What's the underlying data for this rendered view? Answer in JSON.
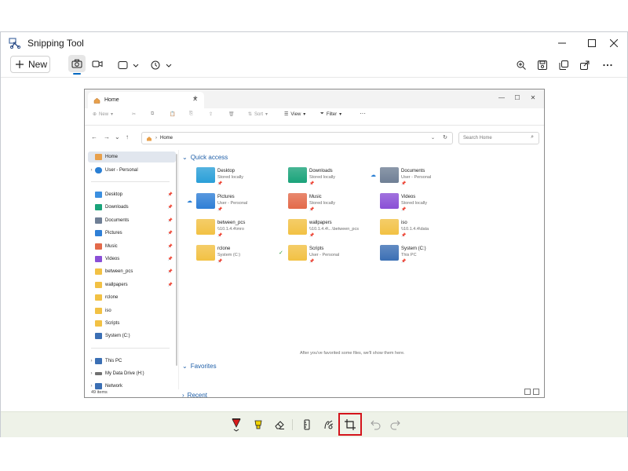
{
  "window": {
    "title": "Snipping Tool",
    "controls": [
      "minimize",
      "maximize",
      "close"
    ]
  },
  "toolbar": {
    "new_label": "New",
    "left_icons": [
      "camera-icon",
      "video-icon",
      "snip-shape-icon",
      "timer-icon"
    ],
    "right_icons": [
      "zoom-icon",
      "save-icon",
      "copy-icon",
      "share-icon",
      "more-icon"
    ]
  },
  "bottom_tools": {
    "items": [
      "ballpoint-pen",
      "highlighter",
      "eraser",
      "ruler",
      "touch-writing",
      "crop",
      "undo",
      "redo"
    ],
    "highlighted": "crop",
    "highlight_color": "#d4141c"
  },
  "explorer": {
    "tab_title": "Home",
    "command_bar": {
      "new": "New",
      "sort": "Sort",
      "view": "View",
      "filter": "Filter",
      "more": "···"
    },
    "address": "Home",
    "search_placeholder": "Search Home",
    "nav": {
      "home": "Home",
      "personal": "User - Personal",
      "pinned": [
        "Desktop",
        "Downloads",
        "Documents",
        "Pictures",
        "Music",
        "Videos",
        "between_pcs",
        "wallpapers",
        "rclone",
        "iso",
        "Scripts",
        "System (C:)"
      ],
      "drives": [
        "This PC",
        "My Data Drive (H:)",
        "Network"
      ]
    },
    "quick_access_title": "Quick access",
    "quick_access": [
      {
        "name": "Desktop",
        "sub": "Stored locally",
        "color": "#2a9fd8"
      },
      {
        "name": "Downloads",
        "sub": "Stored locally",
        "color": "#1aa37a"
      },
      {
        "name": "Documents",
        "sub": "User - Personal",
        "color": "#6f7f95"
      },
      {
        "name": "Pictures",
        "sub": "User - Personal",
        "color": "#2f7fd6"
      },
      {
        "name": "Music",
        "sub": "Stored locally",
        "color": "#e36a4a"
      },
      {
        "name": "Videos",
        "sub": "Stored locally",
        "color": "#8a4fd6"
      },
      {
        "name": "between_pcs",
        "sub": "\\\\10.1.4.4\\mro",
        "color": "#f2c144"
      },
      {
        "name": "wallpapers",
        "sub": "\\\\10.1.4.4\\...\\between_pcs",
        "color": "#f2c144"
      },
      {
        "name": "iso",
        "sub": "\\\\10.1.4.4\\data",
        "color": "#f2c144"
      },
      {
        "name": "rclone",
        "sub": "System (C:)",
        "color": "#f2c144"
      },
      {
        "name": "Scripts",
        "sub": "User - Personal",
        "color": "#f2c144"
      },
      {
        "name": "System (C:)",
        "sub": "This PC",
        "color": "#3b6fb4"
      }
    ],
    "favorites_title": "Favorites",
    "favorites_empty": "After you've favorited some files, we'll show them here.",
    "recent_title": "Recent",
    "status": "49 items"
  }
}
